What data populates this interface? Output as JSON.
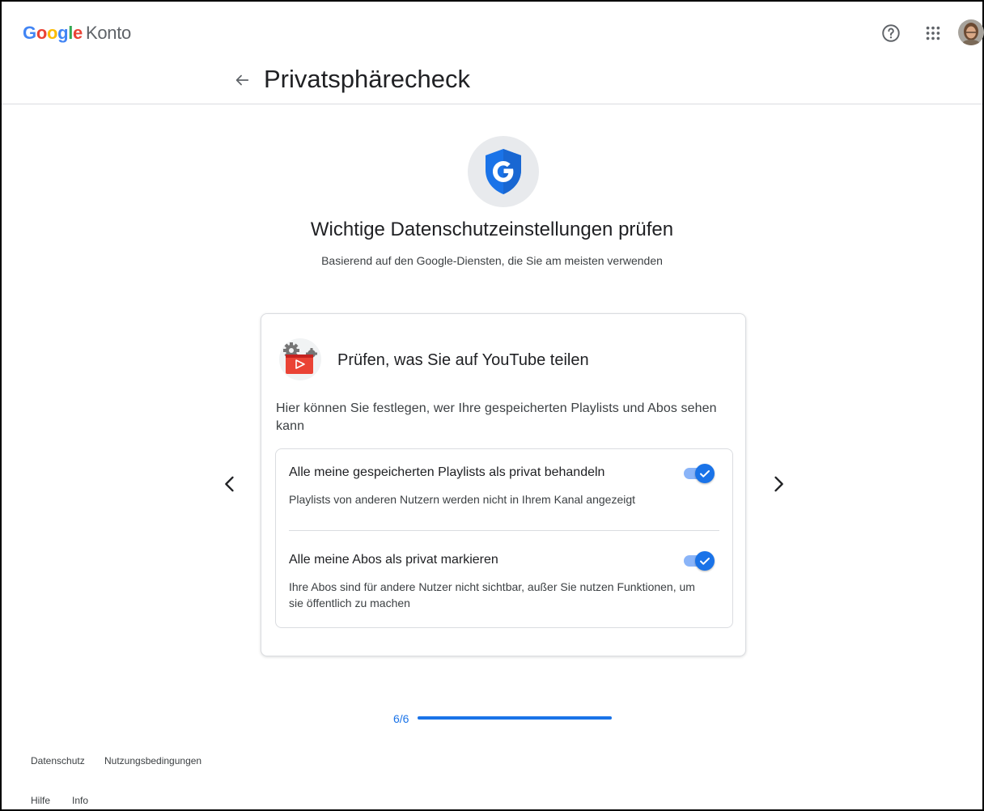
{
  "topbar": {
    "logo_word": "Google",
    "logo_product": "Konto",
    "help_icon": "help-circle-icon",
    "apps_icon": "apps-grid-icon",
    "avatar": "user-avatar"
  },
  "header": {
    "back_icon": "arrow-left-icon",
    "title": "Privatsphärecheck"
  },
  "intro": {
    "heading": "Wichtige Datenschutzeinstellungen prüfen",
    "subheading": "Basierend auf den Google-Diensten, die Sie am meisten verwenden"
  },
  "card": {
    "icon": "youtube-settings-icon",
    "title": "Prüfen, was Sie auf YouTube teilen",
    "description": "Hier können Sie festlegen, wer Ihre gespeicherten Playlists und Abos sehen kann",
    "options": [
      {
        "title": "Alle meine gespeicherten Playlists als privat behandeln",
        "description": "Playlists von anderen Nutzern werden nicht in Ihrem Kanal angezeigt",
        "enabled": true
      },
      {
        "title": "Alle meine Abos als privat markieren",
        "description": "Ihre Abos sind für andere Nutzer nicht sichtbar, außer Sie nutzen Funktionen, um sie öffentlich zu machen",
        "enabled": true
      }
    ]
  },
  "navigation": {
    "prev_icon": "chevron-left-icon",
    "next_icon": "chevron-right-icon"
  },
  "progress": {
    "label": "6/6",
    "fraction": 1.0
  },
  "footer": {
    "links": [
      "Datenschutz",
      "Nutzungsbedingungen",
      "Hilfe",
      "Info"
    ]
  },
  "colors": {
    "accent": "#1a73e8",
    "toggle_track": "#8ab4f8",
    "youtube_red": "#ea4335"
  }
}
